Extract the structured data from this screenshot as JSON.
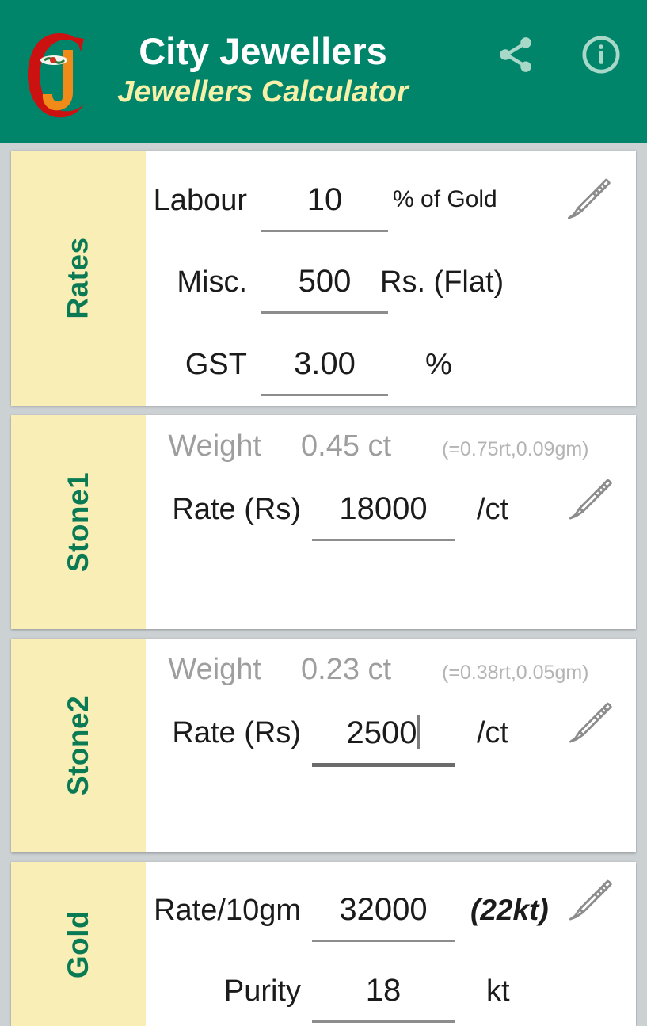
{
  "header": {
    "title": "City Jewellers",
    "subtitle": "Jewellers Calculator",
    "logo_letters": "CJ",
    "share_icon": "share-icon",
    "info_icon": "info-icon",
    "bg_color": "#00856b",
    "title_color": "#ffffff",
    "subtitle_color": "#f7f0a8"
  },
  "colors": {
    "accent_green": "#0a7a55",
    "side_cream": "#faeeb7",
    "page_bg": "#ccd1d3",
    "card_bg": "#ffffff",
    "muted_text": "#9e9e9e",
    "hint_text": "#b4b4b4"
  },
  "cards": {
    "rates": {
      "side_label": "Rates",
      "edit_icon": "pencil-icon",
      "rows": [
        {
          "label": "Labour",
          "value": "10",
          "unit": "% of Gold"
        },
        {
          "label": "Misc.",
          "value": "500",
          "unit": "Rs. (Flat)"
        },
        {
          "label": "GST",
          "value": "3.00",
          "unit": "%"
        }
      ]
    },
    "stone1": {
      "side_label": "Stone1",
      "edit_icon": "pencil-icon",
      "weight_label": "Weight",
      "weight_value": "0.45 ct",
      "weight_hint": "(=0.75rt,0.09gm)",
      "rate_label": "Rate (Rs)",
      "rate_value": "18000",
      "rate_unit": "/ct"
    },
    "stone2": {
      "side_label": "Stone2",
      "edit_icon": "pencil-icon",
      "weight_label": "Weight",
      "weight_value": "0.23 ct",
      "weight_hint": "(=0.38rt,0.05gm)",
      "rate_label": "Rate (Rs)",
      "rate_value": "2500",
      "rate_unit": "/ct",
      "rate_focused": true
    },
    "gold": {
      "side_label": "Gold",
      "edit_icon": "pencil-icon",
      "rate_label": "Rate/10gm",
      "rate_value": "32000",
      "rate_unit": "(22kt)",
      "purity_label": "Purity",
      "purity_value": "18",
      "purity_unit": "kt"
    }
  }
}
